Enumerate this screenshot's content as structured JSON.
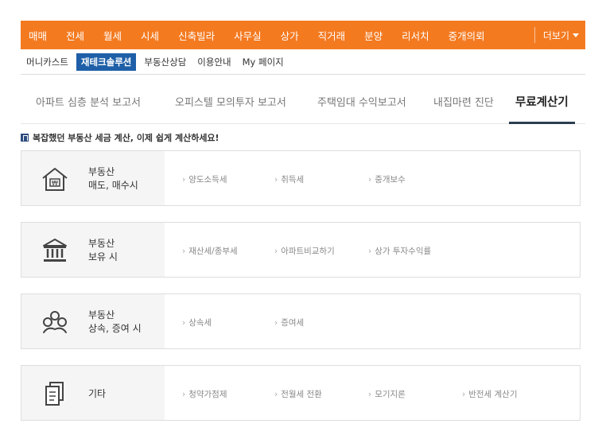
{
  "top_nav": {
    "items": [
      "매매",
      "전세",
      "월세",
      "시세",
      "신축빌라",
      "사무실",
      "상가",
      "직거래",
      "분양",
      "리서치",
      "중개의뢰"
    ],
    "more_label": "더보기"
  },
  "sub_nav": {
    "items": [
      "머니카스트",
      "재테크솔루션",
      "부동산상담",
      "이용안내",
      "My 페이지"
    ],
    "active_index": 1
  },
  "tabs": {
    "items": [
      "아파트 심층 분석 보고서",
      "오피스텔 모의투자 보고서",
      "주택임대 수익보고서",
      "내집마련 진단",
      "무료계산기"
    ],
    "active_index": 4
  },
  "notice": "복잡했던 부동산 세금 계산, 이제 쉽게 계산하세요!",
  "categories": [
    {
      "icon": "house-won-icon",
      "line1": "부동산",
      "line2": "매도, 매수시",
      "links": [
        "양도소득세",
        "취득세",
        "중개보수"
      ]
    },
    {
      "icon": "bank-building-icon",
      "line1": "부동산",
      "line2": "보유 시",
      "links": [
        "재산세/종부세",
        "아파트비교하기",
        "상가 투자수익률"
      ]
    },
    {
      "icon": "family-hands-icon",
      "line1": "부동산",
      "line2": "상속, 증여 시",
      "links": [
        "상속세",
        "증여세"
      ]
    },
    {
      "icon": "documents-icon",
      "line1": "기타",
      "line2": "",
      "links": [
        "청약가점제",
        "전월세 전환",
        "모기지론",
        "반전세 계산기"
      ]
    }
  ],
  "colors": {
    "top_nav_bg": "#f47a20",
    "sub_nav_active_bg": "#1e5fa8",
    "tab_underline": "#2c3e50"
  }
}
